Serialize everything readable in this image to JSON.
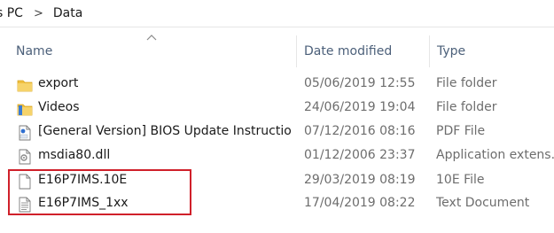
{
  "breadcrumb": {
    "items": [
      "s PC",
      "Data"
    ],
    "separator": ">"
  },
  "columns": {
    "name": "Name",
    "date_modified": "Date modified",
    "type": "Type"
  },
  "files": [
    {
      "icon": "folder-icon",
      "name": "export",
      "date": "05/06/2019 12:55",
      "type": "File folder"
    },
    {
      "icon": "videos-folder-icon",
      "name": "Videos",
      "date": "24/06/2019 19:04",
      "type": "File folder"
    },
    {
      "icon": "pdf-file-icon",
      "name": "[General Version] BIOS Update Instructio...",
      "date": "07/12/2016 08:16",
      "type": "PDF File"
    },
    {
      "icon": "dll-file-icon",
      "name": "msdia80.dll",
      "date": "01/12/2006 23:37",
      "type": "Application extens..."
    },
    {
      "icon": "generic-file-icon",
      "name": "E16P7IMS.10E",
      "date": "29/03/2019 08:19",
      "type": "10E File"
    },
    {
      "icon": "text-file-icon",
      "name": "E16P7IMS_1xx",
      "date": "17/04/2019 08:22",
      "type": "Text Document"
    }
  ],
  "colors": {
    "highlight": "#d0202a",
    "folder": "#f0c040",
    "header_text": "#4c607a"
  }
}
